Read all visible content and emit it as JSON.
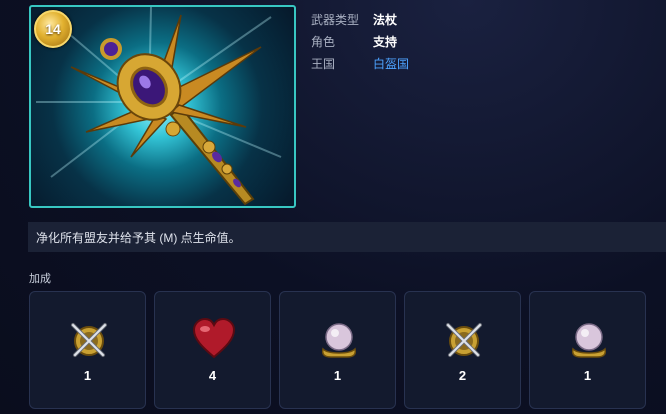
{
  "weapon": {
    "level": "14",
    "icon": "golden-scepter-staff"
  },
  "info": [
    {
      "label": "武器类型",
      "value": "法杖"
    },
    {
      "label": "角色",
      "value": "支持"
    },
    {
      "label": "王国",
      "value": "白盔国"
    }
  ],
  "description": "净化所有盟友并给予其 (M) 点生命值。",
  "bonuses": {
    "title": "加成",
    "items": [
      {
        "icon": "crossed-swords-shield-icon",
        "value": "1"
      },
      {
        "icon": "heart-icon",
        "value": "4"
      },
      {
        "icon": "crystal-orb-icon",
        "value": "1"
      },
      {
        "icon": "crossed-swords-shield-icon",
        "value": "2"
      },
      {
        "icon": "crystal-orb-icon",
        "value": "1"
      }
    ]
  },
  "colors": {
    "accent_teal": "#38c7c2",
    "link_blue": "#4da3ff",
    "gold": "#e2b12f"
  }
}
